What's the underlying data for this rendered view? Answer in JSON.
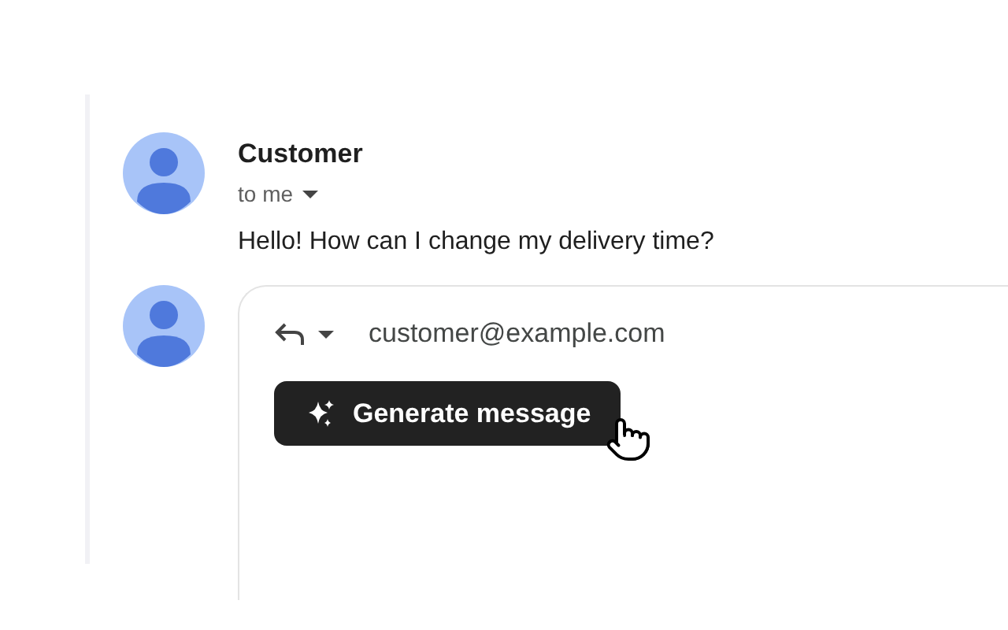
{
  "message": {
    "sender": "Customer",
    "recipient": "to me",
    "body": "Hello! How can I change my delivery time?"
  },
  "reply": {
    "to": "customer@example.com",
    "button": "Generate message"
  }
}
